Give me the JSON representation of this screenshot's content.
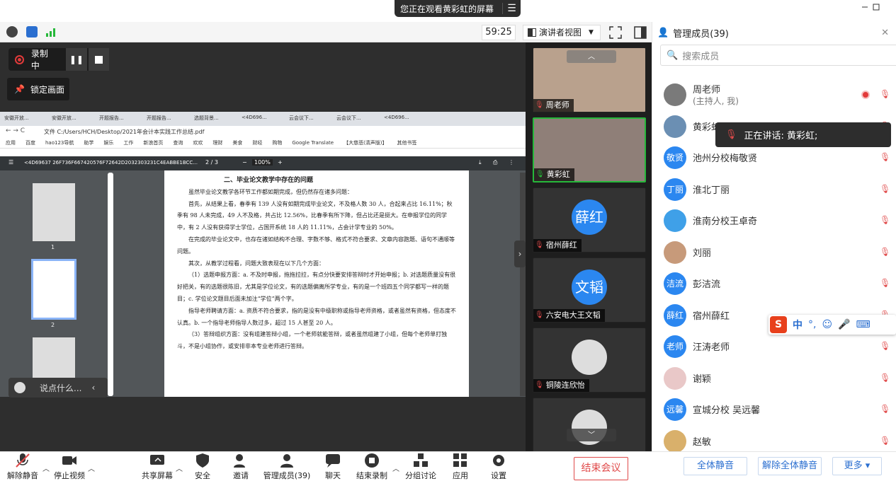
{
  "share_notice": {
    "text": "您正在观看黄彩虹的屏幕"
  },
  "toolbar": {
    "timer": "59:25",
    "view_label": "演讲者视图"
  },
  "recording": {
    "status": "录制中"
  },
  "lock_screen": "锁定画面",
  "browser": {
    "tabs": [
      "安徽开放...",
      "安徽开放...",
      "开题报告...",
      "开题报告...",
      "选题背景...",
      "<4D696...",
      "云会议下...",
      "云会议下...",
      "<4D696..."
    ],
    "address": "文件  C:/Users/HCH/Desktop/2021年会计本实践工作总结.pdf",
    "bookmarks": [
      "应用",
      "百度",
      "hao123导航",
      "助学",
      "娱乐",
      "工作",
      "新浪首页",
      "查询",
      "欢欢",
      "理财",
      "美食",
      "财经",
      "购物",
      "Google Translate",
      "【大慈悲(清声版)】",
      "其他书签"
    ]
  },
  "pdf": {
    "filename": "<4D69637 26F736F667420576F72642D2032303231C4EABBE1BCC...",
    "page_indicator": "2 / 3",
    "zoom": "100%",
    "thumbs": [
      "1",
      "2"
    ],
    "heading": "二、毕业论文教学中存在的问题",
    "paragraphs": [
      "虽然毕业论文教学各环节工作都如期完成，但仍然存在诸多问题：",
      "首先，从结果上看，春季有 139 人没有如期完成毕业论文，不及格人数 30 人，合起来占比 16.11%；秋季有 98 人未完成，49 人不及格，共占比 12.56%，比春季有所下降，但占比还是挺大。在申报学位的同学中，有 2 人没有获得学士学位，占国开系统 18 人的 11.11%，占会计学专业的 50%。",
      "在完成的毕业论文中，也存在诸如结构不合理、字数不够、格式不符合要求、文章内容跑题、语句不通顺等问题。",
      "其次，从教学过程看，问题大致表现在以下几个方面：",
      "（1）选题申报方面：a. 不及时申报，拖拖拉拉，有点分快要安排答辩时才开始申报；b. 对选题质量没有很好把关，有的选题很陈旧，尤其是学位论文，有的选题偏离所学专业，有的是一个班四五个同学都写一样的题目；c. 学位论文题目后面未加注“学位”两个字。",
      "指导老师聘请方面：a. 资质不符合要求，指的是没有中级职称或指导老师资格，或者虽然有资格，但态度不认真。b. 一个指导老师指导人数过多，超过 15 人甚至 20 人。",
      "（3）答辩组织方面：没有组建答辩小组，一个老师就能答辩，或者虽然组建了小组，但每个老师单打独斗，不是小组协作，或安排非本专业老师进行答辩。"
    ]
  },
  "chat": {
    "placeholder": "说点什么..."
  },
  "videos": [
    {
      "name": "周老师",
      "avatar": ""
    },
    {
      "name": "黄彩虹",
      "avatar": ""
    },
    {
      "name": "宿州薛红",
      "avatar": "薛红"
    },
    {
      "name": "六安电大王文韬",
      "avatar": "文韬"
    },
    {
      "name": "铜陵连欣怡",
      "avatar": ""
    },
    {
      "name": "",
      "avatar": ""
    }
  ],
  "panel": {
    "title": "管理成员(39)",
    "search_placeholder": "搜索成员",
    "speaking": "正在讲话: 黄彩虹;",
    "members": [
      {
        "name": "周老师",
        "sub": "(主持人, 我)",
        "avatar": "",
        "color": "#7a7a7a"
      },
      {
        "name": "黄彩虹",
        "sub": "",
        "avatar": "",
        "color": "#6b8fb3"
      },
      {
        "name": "池州分校梅敬贤",
        "sub": "",
        "avatar": "敬贤",
        "color": "#2b87f0"
      },
      {
        "name": "淮北丁丽",
        "sub": "",
        "avatar": "丁丽",
        "color": "#2b87f0"
      },
      {
        "name": "淮南分校王卓奇",
        "sub": "",
        "avatar": "",
        "color": "#3fa0e8"
      },
      {
        "name": "刘丽",
        "sub": "",
        "avatar": "",
        "color": "#c79a7a"
      },
      {
        "name": "彭洁流",
        "sub": "",
        "avatar": "洁流",
        "color": "#2b87f0"
      },
      {
        "name": "宿州薛红",
        "sub": "",
        "avatar": "薛红",
        "color": "#2b87f0"
      },
      {
        "name": "汪涛老师",
        "sub": "",
        "avatar": "老师",
        "color": "#2b87f0"
      },
      {
        "name": "谢颖",
        "sub": "",
        "avatar": "",
        "color": "#e9c8c8"
      },
      {
        "name": "宣城分校 吴远馨",
        "sub": "",
        "avatar": "远馨",
        "color": "#2b87f0"
      },
      {
        "name": "赵敏",
        "sub": "",
        "avatar": "",
        "color": "#d9b06b"
      }
    ],
    "footer": {
      "mute_all": "全体静音",
      "unmute_all": "解除全体静音",
      "more": "更多"
    }
  },
  "ime": {
    "label": "中"
  },
  "bottom": {
    "unmute": "解除静音",
    "stop_video": "停止视频",
    "share_screen": "共享屏幕",
    "security": "安全",
    "invite": "邀请",
    "members": "管理成员(39)",
    "chat": "聊天",
    "end_record": "结束录制",
    "breakout": "分组讨论",
    "apps": "应用",
    "settings": "设置",
    "end_meeting": "结束会议"
  },
  "colors": {
    "accent": "#2b87f0",
    "danger": "#e04a4a",
    "record": "#e23a3a",
    "green": "#26b83a"
  }
}
